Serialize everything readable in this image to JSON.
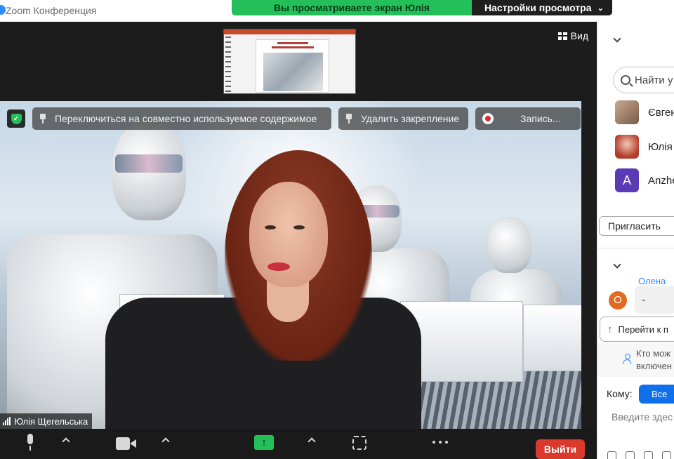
{
  "window": {
    "title": "Zoom Конференция"
  },
  "share_banner": {
    "viewing_text": "Вы просматриваете экран Юлія Щегельська",
    "view_options_label": "Настройки просмотра"
  },
  "stage": {
    "view_label": "Вид",
    "pills": {
      "switch_shared": "Переключиться на совместно используемое содержимое",
      "unpin": "Удалить закрепление",
      "recording": "Запись..."
    },
    "speaker_name": "Юлія Щегельська"
  },
  "toolbar": {
    "leave_label": "Выйти",
    "share_color": "#23c05a",
    "leave_color": "#d93a2b"
  },
  "panel": {
    "search_placeholder": "Найти у",
    "participants": [
      {
        "name": "Євген",
        "avatar": "photo"
      },
      {
        "name": "Юлія",
        "avatar": "photo"
      },
      {
        "name": "Anzhe",
        "avatar": "A"
      }
    ],
    "invite_label": "Пригласить",
    "chat": {
      "sender": "Олена",
      "sender_initial": "О",
      "message": "-",
      "jump_label": "Перейти к п",
      "who_can_line1": "Кто мож",
      "who_can_line2": "включен",
      "to_label": "Кому:",
      "to_value": "Все",
      "input_placeholder": "Введите здес"
    }
  }
}
